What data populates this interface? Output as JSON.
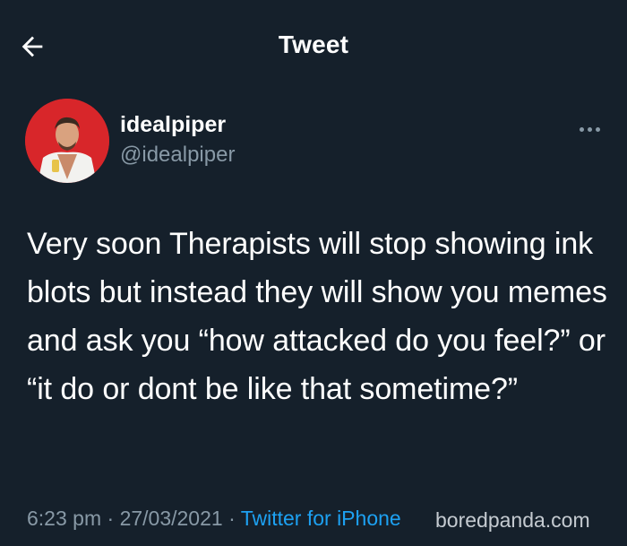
{
  "header": {
    "title": "Tweet",
    "back_icon": "arrow-left-icon"
  },
  "author": {
    "display_name": "idealpiper",
    "handle": "@idealpiper",
    "more_icon": "more-horizontal-icon"
  },
  "tweet": {
    "text": "Very soon Therapists will stop showing ink blots but instead they will show you memes and ask you “how attacked do you feel?” or “it do or dont be like that sometime?”"
  },
  "meta": {
    "time": "6:23 pm",
    "separator1": " · ",
    "date": "27/03/2021",
    "separator2": " · ",
    "source": "Twitter for iPhone"
  },
  "watermark": {
    "text": "boredpanda.com"
  },
  "colors": {
    "background": "#15202b",
    "text": "#ffffff",
    "secondary": "#8899a6",
    "accent": "#1da1f2"
  }
}
